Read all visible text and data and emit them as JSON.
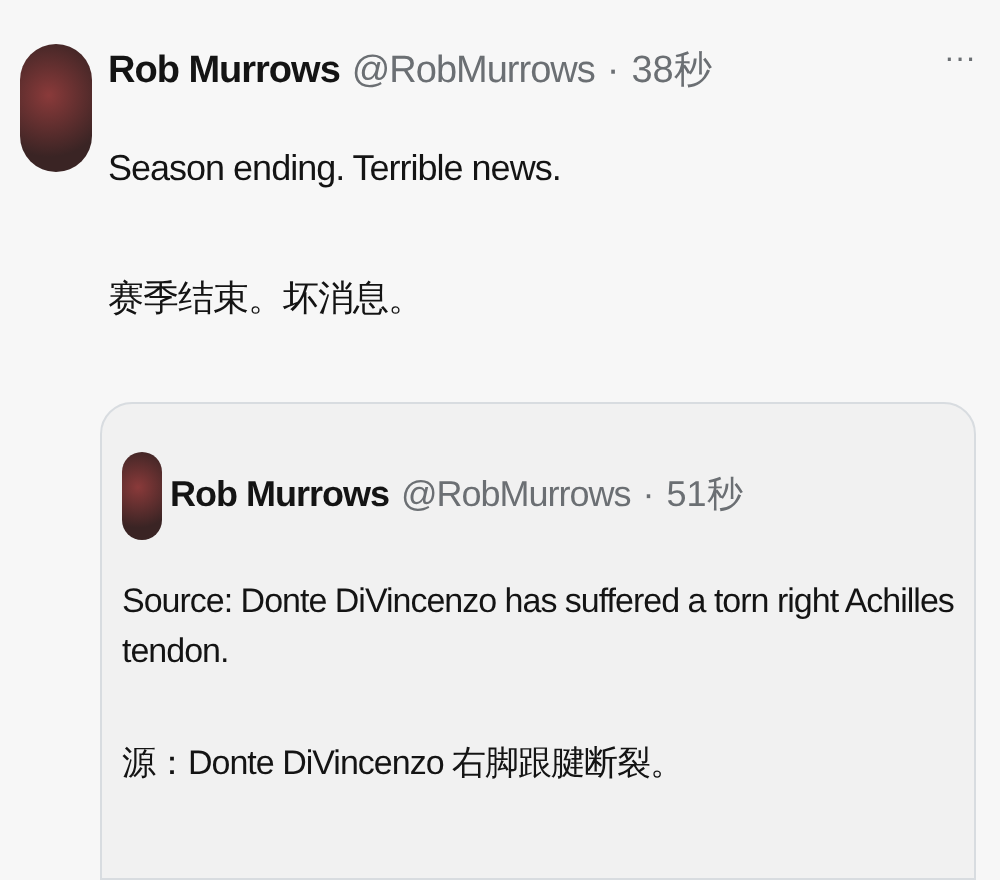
{
  "tweet": {
    "name": "Rob Murrows",
    "handle": "@RobMurrows",
    "time": "38秒",
    "separator": "·",
    "more": "···",
    "paragraphs": [
      "Season ending. Terrible news.",
      "赛季结束。坏消息。"
    ],
    "quote": {
      "name": "Rob Murrows",
      "handle": "@RobMurrows",
      "time": "51秒",
      "separator": "·",
      "paragraphs": [
        "Source: Donte DiVincenzo has suffered a torn right Achilles tendon.",
        "源：Donte DiVincenzo 右脚跟腱断裂。"
      ]
    }
  }
}
